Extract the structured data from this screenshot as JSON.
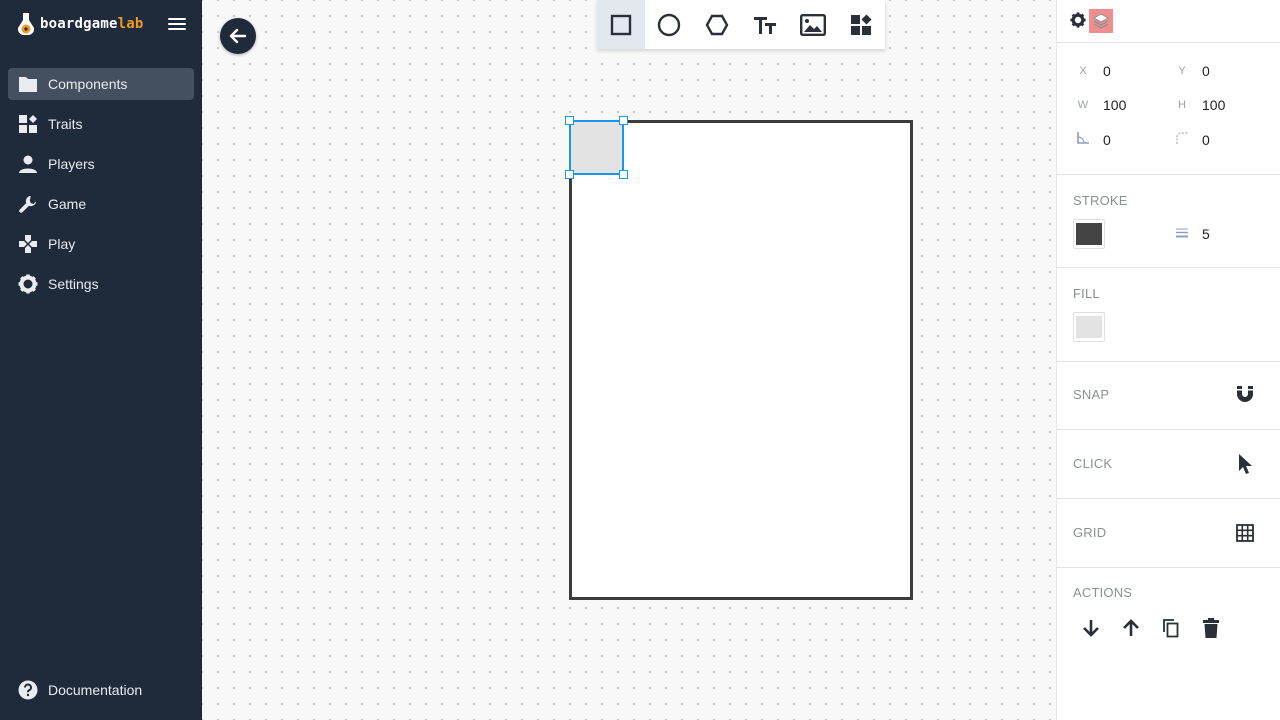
{
  "app": {
    "brand_prefix": "boardgame",
    "brand_suffix": "lab",
    "accent_color": "#f29a1f",
    "sidebar_color": "#1f2a3a"
  },
  "sidebar": {
    "items": [
      {
        "label": "Components",
        "icon": "folder-icon",
        "active": true
      },
      {
        "label": "Traits",
        "icon": "widgets-icon",
        "active": false
      },
      {
        "label": "Players",
        "icon": "person-icon",
        "active": false
      },
      {
        "label": "Game",
        "icon": "wrench-icon",
        "active": false
      },
      {
        "label": "Play",
        "icon": "gamepad-icon",
        "active": false
      },
      {
        "label": "Settings",
        "icon": "gear-icon",
        "active": false
      }
    ],
    "documentation": "Documentation"
  },
  "toolbar": {
    "tools": [
      "rectangle-icon",
      "circle-icon",
      "hexagon-icon",
      "text-icon",
      "image-icon",
      "widgets-icon"
    ],
    "active_tool": "rectangle-icon"
  },
  "properties": {
    "x_label": "X",
    "x": "0",
    "y_label": "Y",
    "y": "0",
    "w_label": "W",
    "w": "100",
    "h_label": "H",
    "h": "100",
    "angle": "0",
    "radius": "0"
  },
  "stroke": {
    "title": "STROKE",
    "color": "#444444",
    "width": "5"
  },
  "fill": {
    "title": "FILL",
    "color": "#e3e3e3"
  },
  "snap": {
    "title": "SNAP",
    "icon": "magnet-icon"
  },
  "click": {
    "title": "CLICK",
    "icon": "cursor-icon"
  },
  "grid": {
    "title": "GRID",
    "icon": "grid-icon"
  },
  "actions": {
    "title": "ACTIONS",
    "icons": [
      "arrow-down-icon",
      "arrow-up-icon",
      "copy-icon",
      "trash-icon"
    ]
  }
}
